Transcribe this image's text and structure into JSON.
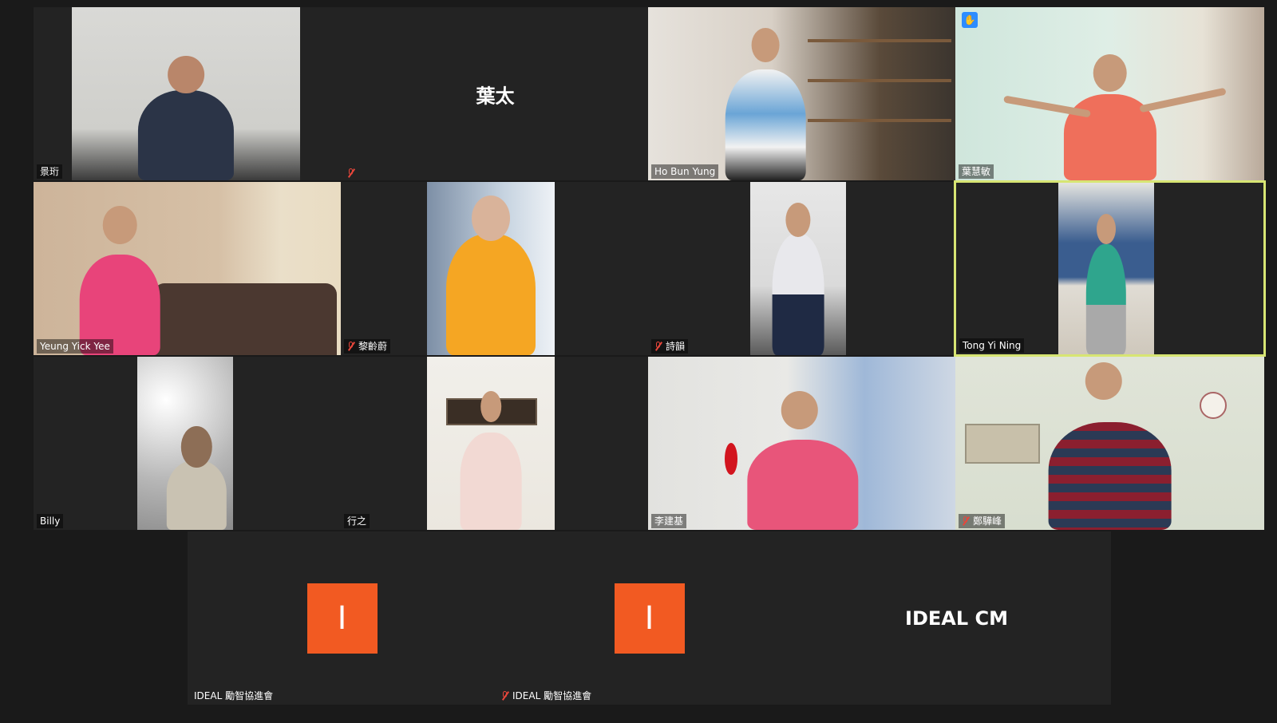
{
  "participants": [
    {
      "name": "景珩",
      "muted": false
    },
    {
      "name": "葉太",
      "muted": true,
      "video": false
    },
    {
      "name": "Ho Bun Yung",
      "muted": false
    },
    {
      "name": "葉慧敏",
      "muted": false,
      "hand_raised": true
    },
    {
      "name": "Yeung Yick Yee",
      "muted": false
    },
    {
      "name": "黎齡蔚",
      "muted": true
    },
    {
      "name": "詩韻",
      "muted": true
    },
    {
      "name": "Tong Yi Ning",
      "muted": false,
      "active_speaker": true
    },
    {
      "name": "Billy",
      "muted": false
    },
    {
      "name": "行之",
      "muted": false
    },
    {
      "name": "李建基",
      "muted": false
    },
    {
      "name": "鄭驊峰",
      "muted": true
    },
    {
      "name": "IDEAL 勵智協進會",
      "muted": false,
      "video": false,
      "avatar_letter": "I"
    },
    {
      "name": "IDEAL 勵智協進會",
      "muted": true,
      "video": false,
      "avatar_letter": "I"
    },
    {
      "name": "IDEAL CM",
      "muted": false,
      "video": false
    }
  ],
  "colors": {
    "background": "#1a1a1a",
    "tile": "#232323",
    "active_border": "#d7e573",
    "avatar_bg": "#f25a22",
    "mute_red": "#e8463b",
    "hand_blue": "#2d8cff"
  },
  "icons": {
    "mute": "mic-muted-icon",
    "hand": "raised-hand-icon"
  }
}
